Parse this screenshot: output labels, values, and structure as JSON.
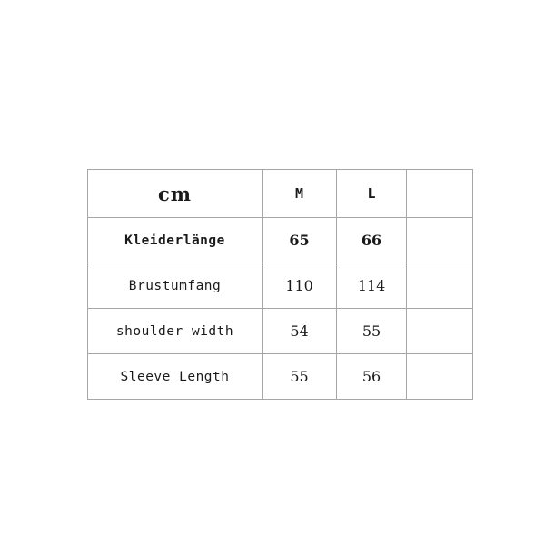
{
  "document": {
    "type": "size-chart",
    "background_color": "#ffffff",
    "border_color": "#a6a6a6",
    "text_color": "#1a1a1a"
  },
  "table": {
    "unit_label": "cm",
    "column_headers": [
      "cm",
      "M",
      "L",
      ""
    ],
    "size_columns": [
      "M",
      "L"
    ],
    "blank_column_label": "",
    "rows": [
      {
        "label": "Kleiderlänge",
        "values": [
          "65",
          "66"
        ],
        "blank": "",
        "emphasis": true
      },
      {
        "label": "Brustumfang",
        "values": [
          "110",
          "114"
        ],
        "blank": "",
        "emphasis": false
      },
      {
        "label": "shoulder width",
        "values": [
          "54",
          "55"
        ],
        "blank": "",
        "emphasis": false
      },
      {
        "label": "Sleeve Length",
        "values": [
          "55",
          "56"
        ],
        "blank": "",
        "emphasis": false
      }
    ]
  },
  "chart_data": {
    "type": "table",
    "title": "",
    "categories": [
      "Kleiderlänge",
      "Brustumfang",
      "shoulder width",
      "Sleeve Length"
    ],
    "series": [
      {
        "name": "M",
        "values": [
          65,
          110,
          54,
          55
        ]
      },
      {
        "name": "L",
        "values": [
          66,
          114,
          55,
          56
        ]
      }
    ],
    "unit": "cm",
    "xlabel": "",
    "ylabel": ""
  }
}
